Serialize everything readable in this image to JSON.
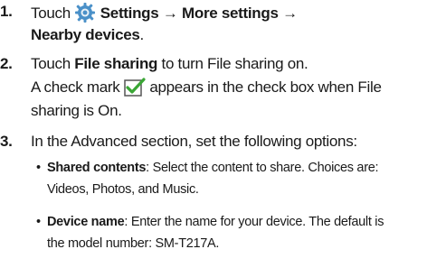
{
  "steps": [
    {
      "number": "1.",
      "line1": {
        "pre": "Touch",
        "icon": "gear-icon",
        "bold1": "Settings",
        "arrow1": "→",
        "bold2": "More settings",
        "arrow2": "→"
      },
      "line2": {
        "bold": "Nearby devices",
        "post": "."
      }
    },
    {
      "number": "2.",
      "line1": {
        "pre": "Touch ",
        "bold": "File sharing",
        "post": " to turn File sharing on."
      },
      "line2": {
        "pre": "A check mark",
        "icon": "checkbox-checked-icon",
        "post": "appears in the check box when File"
      },
      "line3": "sharing is On."
    },
    {
      "number": "3.",
      "line1": "In the Advanced section, set the following options:",
      "bullets": [
        {
          "bullet": "•",
          "term": "Shared contents",
          "text1": ": Select the content to share. Choices are:",
          "text2": "Videos, Photos, and Music."
        },
        {
          "bullet": "•",
          "term": "Device name",
          "text1": ": Enter the name for your device. The default is",
          "text2": "the model number: SM-T217A."
        }
      ]
    }
  ],
  "colors": {
    "text": "#1a1a1a",
    "gear": "#4a90c8",
    "check": "#3aa635"
  }
}
